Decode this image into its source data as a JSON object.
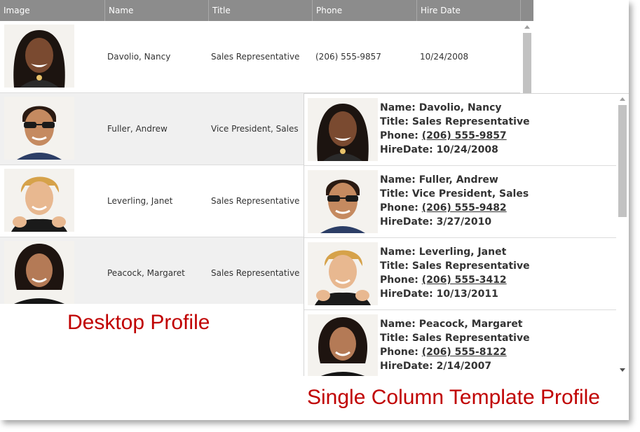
{
  "desktop": {
    "columns": [
      "Image",
      "Name",
      "Title",
      "Phone",
      "Hire Date"
    ],
    "rows": [
      {
        "name": "Davolio, Nancy",
        "title": "Sales Representative",
        "phone": "(206) 555-9857",
        "hire": "10/24/2008"
      },
      {
        "name": "Fuller, Andrew",
        "title": "Vice President, Sales",
        "phone": "",
        "hire": ""
      },
      {
        "name": "Leverling, Janet",
        "title": "Sales Representative",
        "phone": "",
        "hire": ""
      },
      {
        "name": "Peacock, Margaret",
        "title": "Sales Representative",
        "phone": "",
        "hire": ""
      }
    ],
    "caption": "Desktop Profile"
  },
  "single": {
    "labels": {
      "name": "Name: ",
      "title": "Title: ",
      "phone": "Phone: ",
      "hire": "HireDate: "
    },
    "rows": [
      {
        "name": "Davolio, Nancy",
        "title": "Sales Representative",
        "phone": "(206) 555-9857",
        "hire": "10/24/2008"
      },
      {
        "name": "Fuller, Andrew",
        "title": "Vice President, Sales",
        "phone": "(206) 555-9482",
        "hire": "3/27/2010"
      },
      {
        "name": "Leverling, Janet",
        "title": "Sales Representative",
        "phone": "(206) 555-3412",
        "hire": "10/13/2011"
      },
      {
        "name": "Peacock, Margaret",
        "title": "Sales Representative",
        "phone": "(206) 555-8122",
        "hire": "2/14/2007"
      }
    ],
    "caption": "Single Column Template Profile"
  },
  "colors": {
    "header_bg": "#8c8c8c",
    "alt_row": "#f0f0f0",
    "caption": "#c00000"
  }
}
